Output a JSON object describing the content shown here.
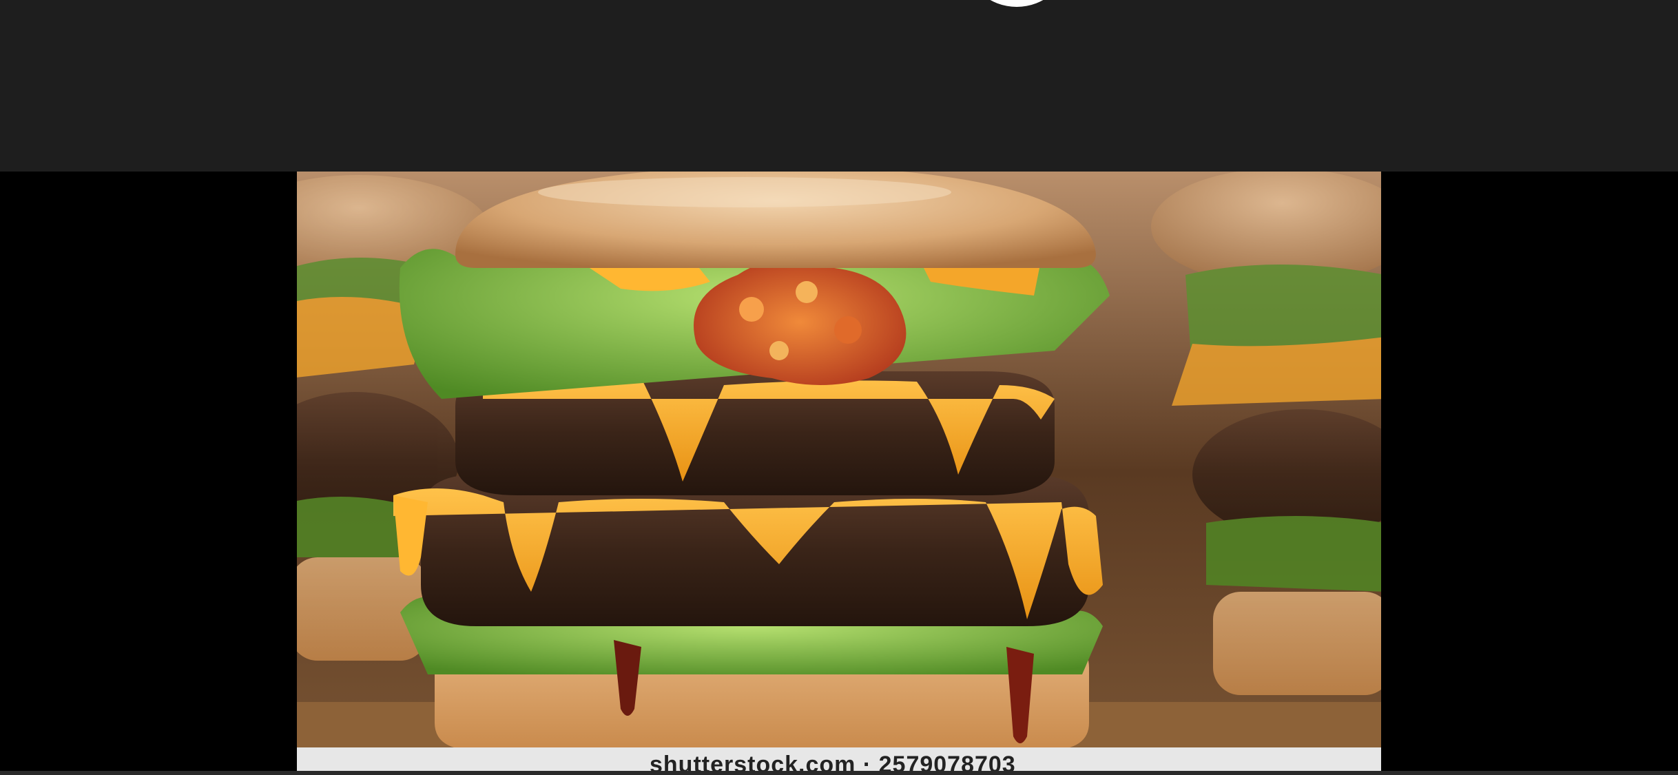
{
  "viewer": {
    "image_alt": "Double cheeseburger with melted cheddar, lettuce and salsa topping",
    "watermark": "shutterstock.com · 2579078703"
  },
  "colors": {
    "top_bar": "#1e1e1e",
    "background": "#000000",
    "watermark_bar": "#e7e7e7"
  }
}
